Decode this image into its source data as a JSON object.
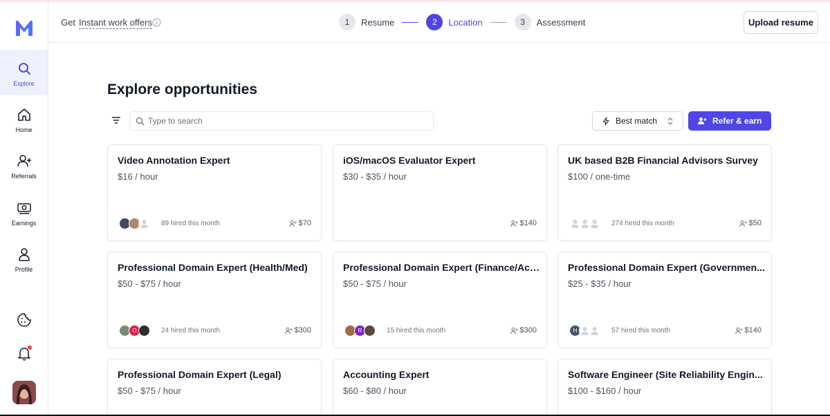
{
  "header": {
    "get_text": "Get",
    "offer_link": "Instant work offers",
    "steps": [
      {
        "num": "1",
        "label": "Resume"
      },
      {
        "num": "2",
        "label": "Location"
      },
      {
        "num": "3",
        "label": "Assessment"
      }
    ],
    "upload_label": "Upload resume"
  },
  "sidebar": {
    "items": [
      {
        "label": "Explore",
        "icon": "search-icon"
      },
      {
        "label": "Home",
        "icon": "home-icon"
      },
      {
        "label": "Referrals",
        "icon": "person-plus-icon"
      },
      {
        "label": "Earnings",
        "icon": "cash-icon"
      },
      {
        "label": "Profile",
        "icon": "user-icon"
      }
    ]
  },
  "main": {
    "title": "Explore opportunities",
    "search_placeholder": "Type to search",
    "sort_label": "Best match",
    "refer_label": "Refer & earn"
  },
  "colors": {
    "accent": "#4f46e5",
    "border": "#e5e7eb",
    "text_muted": "#6b7280"
  },
  "cards": [
    {
      "title": "Video Annotation Expert",
      "rate": "$16 / hour",
      "hired": "89 hired this month",
      "referral": "$70",
      "avatars": [
        "photo",
        "photo",
        "ghost"
      ]
    },
    {
      "title": "iOS/macOS Evaluator Expert",
      "rate": "$30 - $35 / hour",
      "hired": "",
      "referral": "$140",
      "avatars": []
    },
    {
      "title": "UK based B2B Financial Advisors Survey",
      "rate": "$100 / one-time",
      "hired": "274 hired this month",
      "referral": "$50",
      "avatars": [
        "ghost",
        "ghost",
        "ghost"
      ]
    },
    {
      "title": "Professional Domain Expert (Health/Med)",
      "rate": "$50 - $75 / hour",
      "hired": "24 hired this month",
      "referral": "$300",
      "avatars": [
        "photo",
        "O",
        "photo"
      ]
    },
    {
      "title": "Professional Domain Expert (Finance/Acc...",
      "rate": "$50 - $75 / hour",
      "hired": "15 hired this month",
      "referral": "$300",
      "avatars": [
        "photo",
        "R",
        "photo"
      ]
    },
    {
      "title": "Professional Domain Expert (Governmen...",
      "rate": "$25 - $35 / hour",
      "hired": "57 hired this month",
      "referral": "$140",
      "avatars": [
        "H",
        "ghost",
        "ghost"
      ]
    },
    {
      "title": "Professional Domain Expert (Legal)",
      "rate": "$50 - $75 / hour",
      "hired": "",
      "referral": "",
      "avatars": []
    },
    {
      "title": "Accounting Expert",
      "rate": "$60 - $80 / hour",
      "hired": "",
      "referral": "",
      "avatars": []
    },
    {
      "title": "Software Engineer (Site Reliability Engin...",
      "rate": "$100 - $160 / hour",
      "hired": "",
      "referral": "",
      "avatars": []
    }
  ]
}
